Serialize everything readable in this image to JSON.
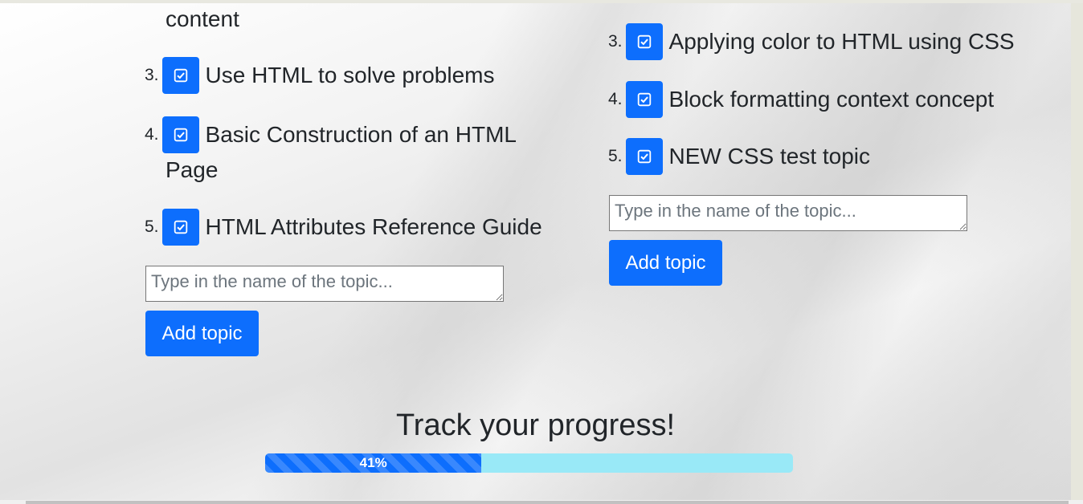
{
  "left_list": {
    "fragment": "content",
    "items": [
      {
        "number": "3.",
        "label": "Use HTML to solve problems"
      },
      {
        "number": "4.",
        "label": "Basic Construction of an HTML",
        "label_cont": "Page"
      },
      {
        "number": "5.",
        "label": "HTML Attributes Reference Guide"
      }
    ],
    "input_placeholder": "Type in the name of the topic...",
    "add_button": "Add topic"
  },
  "right_list": {
    "items": [
      {
        "number": "3.",
        "label": "Applying color to HTML using CSS"
      },
      {
        "number": "4.",
        "label": "Block formatting context concept"
      },
      {
        "number": "5.",
        "label": "NEW CSS test topic"
      }
    ],
    "input_placeholder": "Type in the name of the topic...",
    "add_button": "Add topic"
  },
  "progress": {
    "title": "Track your progress!",
    "label": "41%",
    "value_percent": 41
  },
  "colors": {
    "accent": "#0d6efd",
    "progress_track": "#99e9f7"
  },
  "icons": {
    "checkbox": "check-square-icon"
  }
}
